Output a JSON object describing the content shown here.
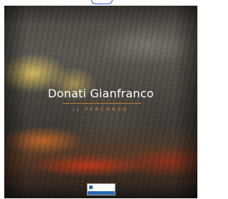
{
  "cover": {
    "title": "Donati Gianfranco",
    "subtitle": "IL PERCORSO",
    "colors": {
      "title": "#ffffff",
      "subtitle": "#e2893b",
      "rule": "#e28c3c",
      "logo_blue": "#2b67b1",
      "top_arc": "#2a5bd7"
    }
  },
  "logo": {
    "icon": "publisher-logo-icon"
  }
}
